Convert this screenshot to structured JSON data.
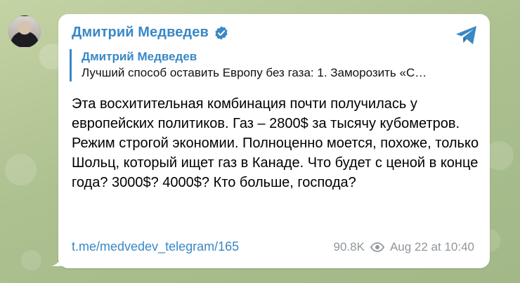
{
  "post": {
    "author": "Дмитрий Медведев",
    "quote": {
      "author": "Дмитрий Медведев",
      "text": "Лучший способ оставить Европу без газа: 1. Заморозить «С…"
    },
    "paragraphs": [
      "Эта восхитительная комбинация почти получилась у европейских политиков. Газ – 2800$ за тысячу кубометров.",
      "Режим строгой экономии. Полноценно моется, похоже, только Шольц, который ищет газ в Канаде. Что будет с ценой в конце года? 3000$? 4000$? Кто больше, господа?"
    ],
    "link": "t.me/medvedev_telegram/165",
    "views": "90.8K",
    "date": "Aug 22 at 10:40"
  },
  "icons": {
    "verified": "verified-badge-icon",
    "share": "telegram-paper-plane-icon",
    "views": "eye-icon"
  },
  "colors": {
    "accent": "#3a88c5",
    "meta": "#8f969c",
    "background": "#b7c79a"
  }
}
